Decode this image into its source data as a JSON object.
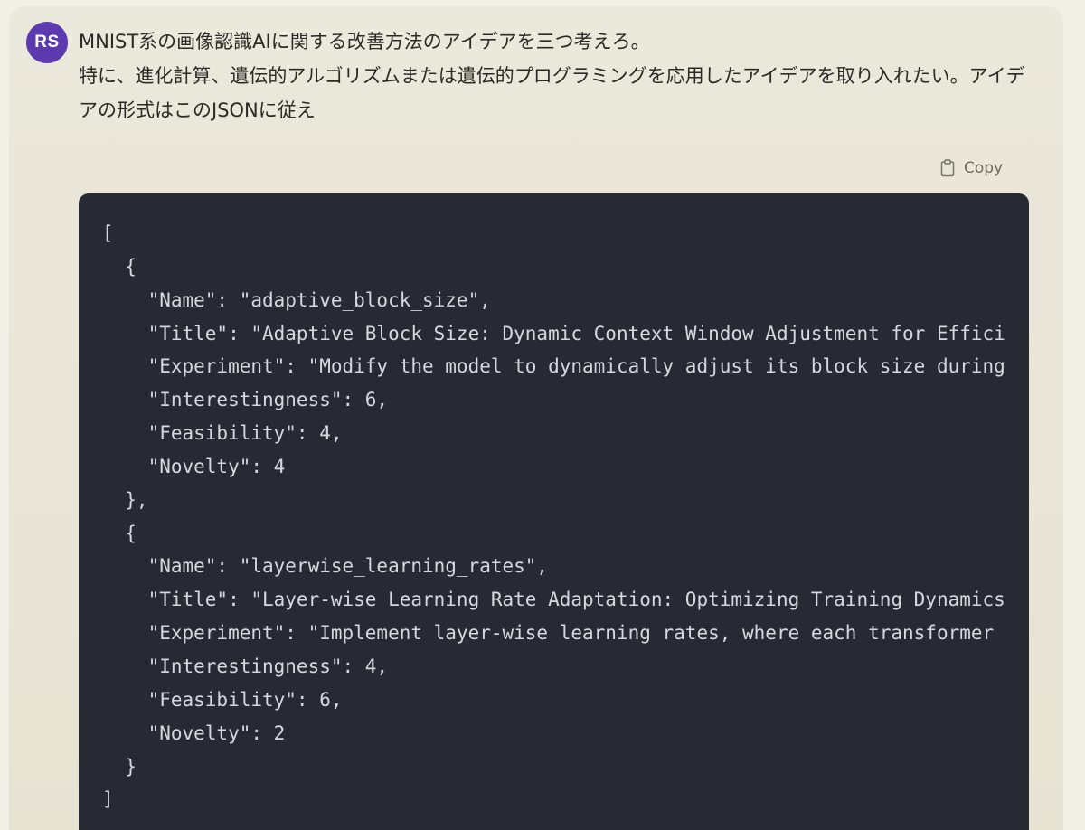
{
  "user": {
    "avatar_initials": "RS",
    "avatar_color": "#5c3ab0"
  },
  "prompt": {
    "line1": "MNIST系の画像認識AIに関する改善方法のアイデアを三つ考えろ。",
    "line2": "特に、進化計算、遺伝的アルゴリズムまたは遺伝的プログラミングを応用したアイデアを取り入れたい。アイデアの形式はこのJSONに従え"
  },
  "code_toolbar": {
    "copy_label": "Copy",
    "copy_icon": "clipboard-icon"
  },
  "code": {
    "background": "#272a33",
    "lines": [
      "[",
      "  {",
      "    \"Name\": \"adaptive_block_size\",",
      "    \"Title\": \"Adaptive Block Size: Dynamic Context Window Adjustment for Effici",
      "    \"Experiment\": \"Modify the model to dynamically adjust its block size during",
      "    \"Interestingness\": 6,",
      "    \"Feasibility\": 4,",
      "    \"Novelty\": 4",
      "  },",
      "  {",
      "    \"Name\": \"layerwise_learning_rates\",",
      "    \"Title\": \"Layer-wise Learning Rate Adaptation: Optimizing Training Dynamics",
      "    \"Experiment\": \"Implement layer-wise learning rates, where each transformer",
      "    \"Interestingness\": 4,",
      "    \"Feasibility\": 6,",
      "    \"Novelty\": 2",
      "  }",
      "]"
    ]
  }
}
